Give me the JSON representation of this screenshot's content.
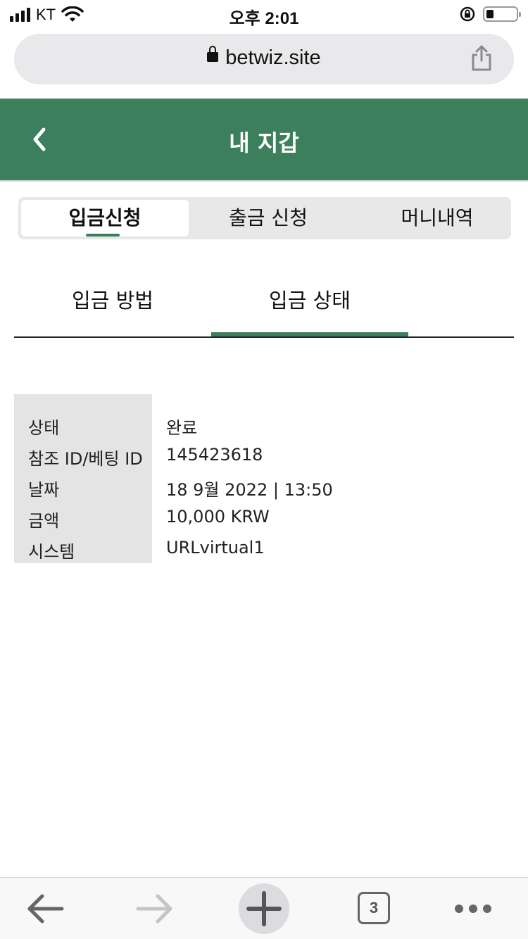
{
  "status_bar": {
    "carrier": "KT",
    "time": "오후 2:01",
    "battery_level": 0.25
  },
  "browser": {
    "url": "betwiz.site"
  },
  "header": {
    "title": "내 지갑"
  },
  "segments": [
    {
      "label": "입금신청",
      "active": true
    },
    {
      "label": "출금 신청",
      "active": false
    },
    {
      "label": "머니내역",
      "active": false
    }
  ],
  "sub_tabs": [
    {
      "label": "입금 방법",
      "active": false
    },
    {
      "label": "입금 상태",
      "active": true
    }
  ],
  "details": [
    {
      "label": "상태",
      "value": "완료"
    },
    {
      "label": "참조 ID/베팅 ID",
      "value": "145423618"
    },
    {
      "label": "날짜",
      "value": "18 9월 2022 | 13:50"
    },
    {
      "label": "금액",
      "value": "10,000 KRW"
    },
    {
      "label": "시스템",
      "value": "URLvirtual1"
    }
  ],
  "toolbar": {
    "tabs_count": "3"
  },
  "colors": {
    "accent": "#3c7f5d"
  }
}
